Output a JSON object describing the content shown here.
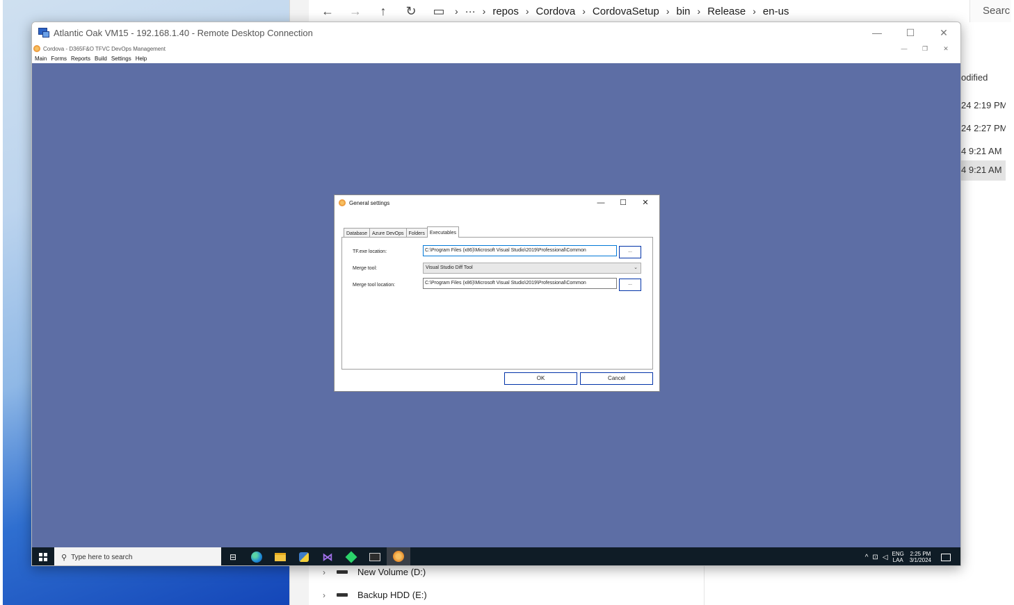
{
  "host": {
    "explorer": {
      "breadcrumb": [
        "repos",
        "Cordova",
        "CordovaSetup",
        "bin",
        "Release",
        "en-us"
      ],
      "more_label": "···",
      "search_placeholder": "Searc",
      "column_modified": "odified",
      "rows": [
        {
          "date": "24 2:19 PM"
        },
        {
          "date": "24 2:27 PM"
        },
        {
          "date": "4 9:21 AM"
        },
        {
          "date": "4 9:21 AM"
        }
      ],
      "tree": [
        {
          "label": "New Volume (D:)"
        },
        {
          "label": "Backup HDD (E:)"
        }
      ]
    }
  },
  "rdp": {
    "title": "Atlantic Oak VM15 - 192.168.1.40 - Remote Desktop Connection",
    "app": {
      "title": "Cordova - D365F&O TFVC DevOps Management",
      "menu": [
        "Main",
        "Forms",
        "Reports",
        "Build",
        "Settings",
        "Help"
      ]
    },
    "dialog": {
      "title": "General settings",
      "tabs": [
        "Database",
        "Azure DevOps",
        "Folders",
        "Executables"
      ],
      "active_tab": "Executables",
      "fields": {
        "tf_label": "TF.exe location:",
        "tf_value": "C:\\Program Files (x86)\\Microsoft Visual Studio\\2019\\Professional\\Common",
        "merge_tool_label": "Merge tool:",
        "merge_tool_value": "Visual Studio Diff Tool",
        "merge_location_label": "Merge tool location:",
        "merge_location_value": "C:\\Program Files (x86)\\Microsoft Visual Studio\\2019\\Professional\\Common",
        "browse_label": "..."
      },
      "ok_label": "OK",
      "cancel_label": "Cancel"
    },
    "taskbar": {
      "search_placeholder": "Type here to search",
      "lang_top": "ENG",
      "lang_bottom": "LAA",
      "time": "2:25 PM",
      "date": "3/1/2024"
    }
  },
  "colors": {
    "remote_background": "#5d6ea5",
    "taskbar": "#0f1c26",
    "button_border": "#0032a8"
  }
}
